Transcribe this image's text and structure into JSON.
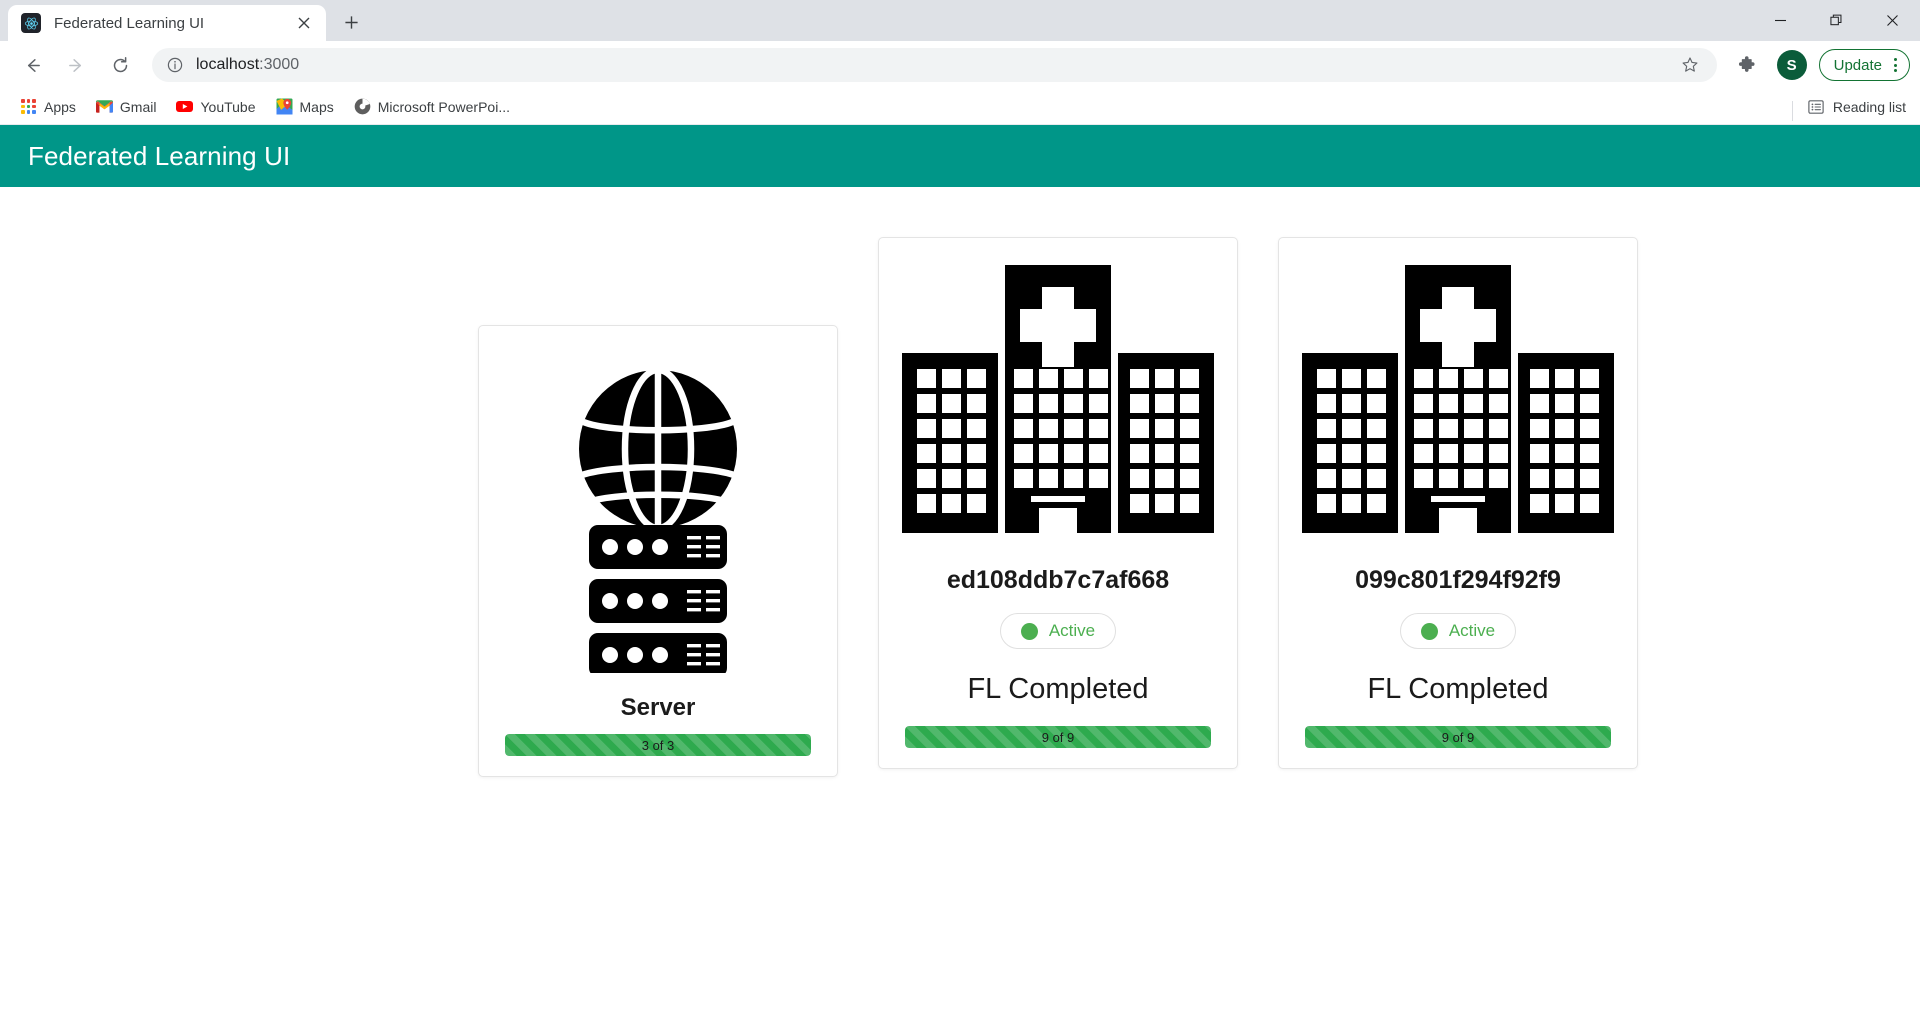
{
  "browser": {
    "tab": {
      "title": "Federated Learning UI",
      "favicon_icon": "react-logo-icon",
      "close_icon": "close-icon"
    },
    "new_tab_icon": "plus-icon",
    "window_controls": {
      "minimize_icon": "minimize-icon",
      "maximize_icon": "restore-window-icon",
      "close_icon": "close-window-icon"
    },
    "nav": {
      "back_icon": "arrow-left-icon",
      "forward_icon": "arrow-right-icon",
      "reload_icon": "reload-icon"
    },
    "omnibox": {
      "info_icon": "info-circle-icon",
      "url_host": "localhost",
      "url_port": ":3000",
      "star_icon": "star-icon"
    },
    "extensions_icon": "puzzle-piece-icon",
    "profile": {
      "initial": "S",
      "color": "#0b5c3a"
    },
    "update_button": {
      "label": "Update",
      "color": "#137333",
      "menu_icon": "kebab-menu-icon"
    },
    "bookmarks": [
      {
        "label": "Apps",
        "icon": "apps-grid-icon"
      },
      {
        "label": "Gmail",
        "icon": "gmail-icon"
      },
      {
        "label": "YouTube",
        "icon": "youtube-icon"
      },
      {
        "label": "Maps",
        "icon": "google-maps-icon"
      },
      {
        "label": "Microsoft PowerPoi...",
        "icon": "microsoft-powerpoint-icon"
      }
    ],
    "reading_list": {
      "label": "Reading list",
      "icon": "reading-list-icon"
    }
  },
  "app": {
    "header": {
      "title": "Federated Learning UI",
      "background": "#009688"
    },
    "server": {
      "icon": "server-globe-icon",
      "name": "Server",
      "progress": {
        "label": "3 of 3",
        "value": 3,
        "max": 3,
        "percent": 100,
        "color": "#2eaa4e"
      }
    },
    "clients": [
      {
        "icon": "hospital-icon",
        "id": "ed108ddb7c7af668",
        "status": {
          "label": "Active",
          "color": "#4caf50",
          "dot_icon": "status-dot-icon"
        },
        "fl_status": "FL Completed",
        "progress": {
          "label": "9 of 9",
          "value": 9,
          "max": 9,
          "percent": 100,
          "color": "#2eaa4e"
        }
      },
      {
        "icon": "hospital-icon",
        "id": "099c801f294f92f9",
        "status": {
          "label": "Active",
          "color": "#4caf50",
          "dot_icon": "status-dot-icon"
        },
        "fl_status": "FL Completed",
        "progress": {
          "label": "9 of 9",
          "value": 9,
          "max": 9,
          "percent": 100,
          "color": "#2eaa4e"
        }
      }
    ]
  }
}
